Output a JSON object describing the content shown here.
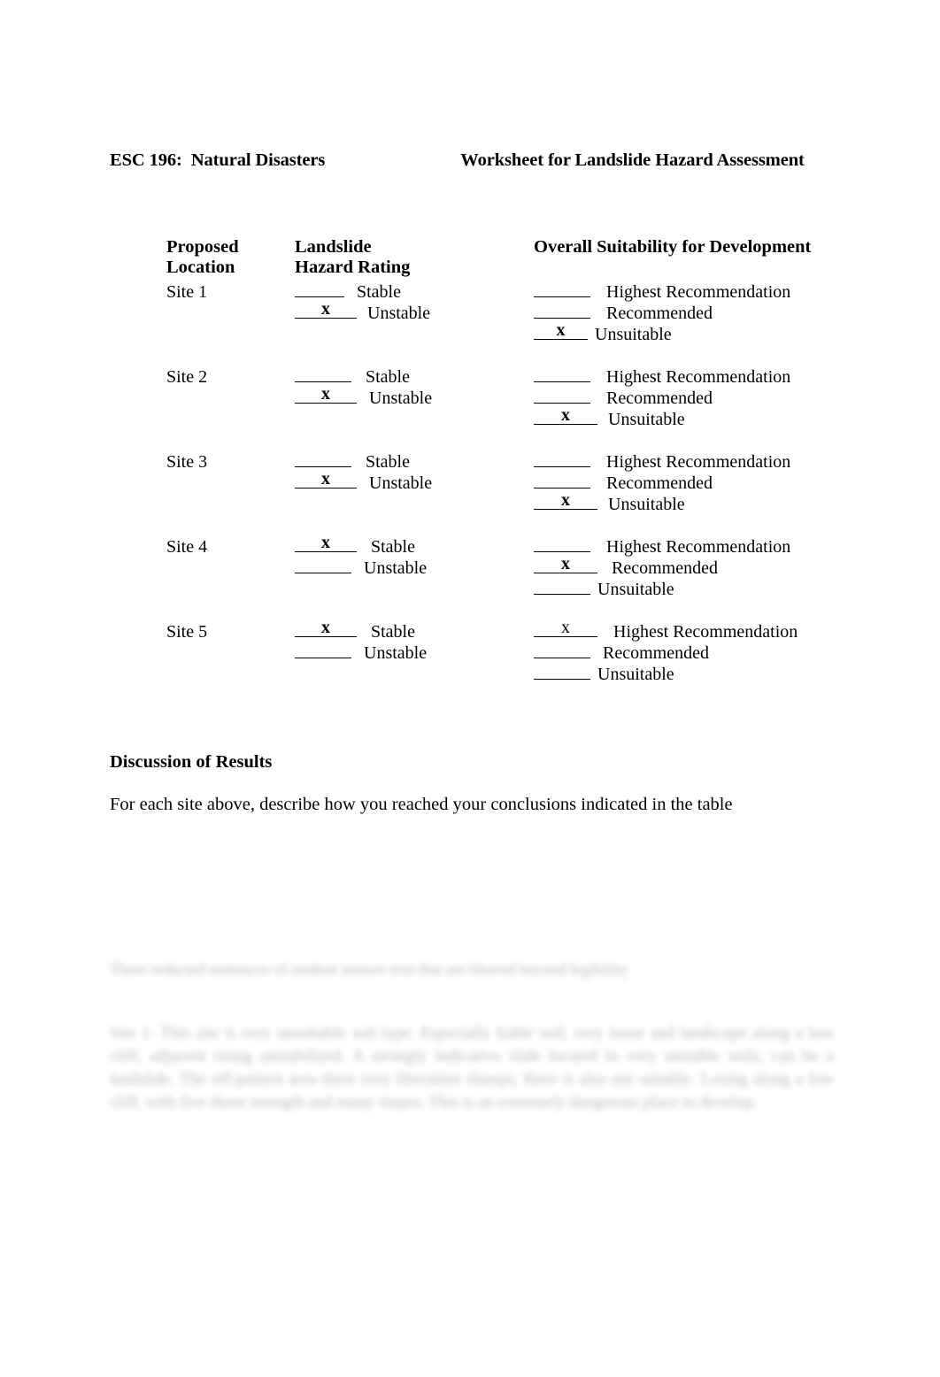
{
  "document": {
    "course": "ESC 196:  Natural Disasters",
    "title": "Worksheet for Landslide Hazard Assessment"
  },
  "table": {
    "headers": {
      "location": "Proposed\nLocation",
      "hazard": "Landslide\nHazard Rating",
      "overall": "Overall Suitability for Development"
    },
    "hazard_options": [
      "Stable",
      "Unstable"
    ],
    "overall_options": [
      "Highest Recommendation",
      "Recommended",
      "Unsuitable"
    ],
    "mark": "x",
    "rows": [
      {
        "site": "Site 1",
        "hazard": [
          {
            "label": "Stable",
            "mark": "",
            "bold": false,
            "blank_width": 56,
            "gap": 14
          },
          {
            "label": "Unstable",
            "mark": "x",
            "bold": true,
            "blank_width": 70,
            "gap": 12
          }
        ],
        "overall": [
          {
            "label": "Highest Recommendation",
            "mark": "",
            "bold": false,
            "blank_width": 64,
            "gap": 18
          },
          {
            "label": "Recommended",
            "mark": "",
            "bold": false,
            "blank_width": 64,
            "gap": 18
          },
          {
            "label": "Unsuitable",
            "mark": "x",
            "bold": true,
            "blank_width": 61,
            "gap": 8
          }
        ]
      },
      {
        "site": "Site 2",
        "hazard": [
          {
            "label": "Stable",
            "mark": "",
            "bold": false,
            "blank_width": 64,
            "gap": 16
          },
          {
            "label": "Unstable",
            "mark": "x",
            "bold": true,
            "blank_width": 70,
            "gap": 14
          }
        ],
        "overall": [
          {
            "label": "Highest Recommendation",
            "mark": "",
            "bold": false,
            "blank_width": 64,
            "gap": 18
          },
          {
            "label": "Recommended",
            "mark": "",
            "bold": false,
            "blank_width": 64,
            "gap": 18
          },
          {
            "label": "Unsuitable",
            "mark": "x",
            "bold": true,
            "blank_width": 72,
            "gap": 12
          }
        ]
      },
      {
        "site": "Site 3",
        "hazard": [
          {
            "label": "Stable",
            "mark": "",
            "bold": false,
            "blank_width": 64,
            "gap": 16
          },
          {
            "label": "Unstable",
            "mark": "x",
            "bold": true,
            "blank_width": 70,
            "gap": 14
          }
        ],
        "overall": [
          {
            "label": "Highest Recommendation",
            "mark": "",
            "bold": false,
            "blank_width": 64,
            "gap": 18
          },
          {
            "label": "Recommended",
            "mark": "",
            "bold": false,
            "blank_width": 64,
            "gap": 18
          },
          {
            "label": "Unsuitable",
            "mark": "x",
            "bold": true,
            "blank_width": 72,
            "gap": 12
          }
        ]
      },
      {
        "site": "Site 4",
        "hazard": [
          {
            "label": "Stable",
            "mark": "x",
            "bold": true,
            "blank_width": 70,
            "gap": 16
          },
          {
            "label": "Unstable",
            "mark": "",
            "bold": false,
            "blank_width": 64,
            "gap": 14
          }
        ],
        "overall": [
          {
            "label": "Highest Recommendation",
            "mark": "",
            "bold": false,
            "blank_width": 64,
            "gap": 18
          },
          {
            "label": "Recommended",
            "mark": "x",
            "bold": true,
            "blank_width": 72,
            "gap": 16
          },
          {
            "label": "Unsuitable",
            "mark": "",
            "bold": false,
            "blank_width": 64,
            "gap": 8
          }
        ]
      },
      {
        "site": "Site 5",
        "hazard": [
          {
            "label": "Stable",
            "mark": "x",
            "bold": true,
            "blank_width": 70,
            "gap": 16
          },
          {
            "label": "Unstable",
            "mark": "",
            "bold": false,
            "blank_width": 64,
            "gap": 14
          }
        ],
        "overall": [
          {
            "label": "Highest Recommendation",
            "mark": "x",
            "bold": false,
            "blank_width": 72,
            "gap": 18
          },
          {
            "label": "Recommended",
            "mark": "",
            "bold": false,
            "blank_width": 64,
            "gap": 14
          },
          {
            "label": "Unsuitable",
            "mark": "",
            "bold": false,
            "blank_width": 64,
            "gap": 8
          }
        ]
      }
    ]
  },
  "discussion": {
    "heading": "Discussion of Results",
    "prompt": "For each site above, describe how you reached your conclusions indicated in the table"
  },
  "redacted": {
    "note": "blurred handwritten-style answer text, illegible in the screenshot",
    "block_a": "Three redacted sentences of student answer text that are blurred beyond legibility",
    "block_b": "Site 1: This site is very unsuitable soil type. Especially liable soil, very loose and landscape along a low cliff, adjacent rising unstabilized. A strongly indicative slide located in very unstable soils, can be a landslide. The off-pattern area there very liberation slumps, there is also not suitable. Losing along a low cliff, with five those strength and many slopes. This is an extremely dangerous place to develop."
  }
}
